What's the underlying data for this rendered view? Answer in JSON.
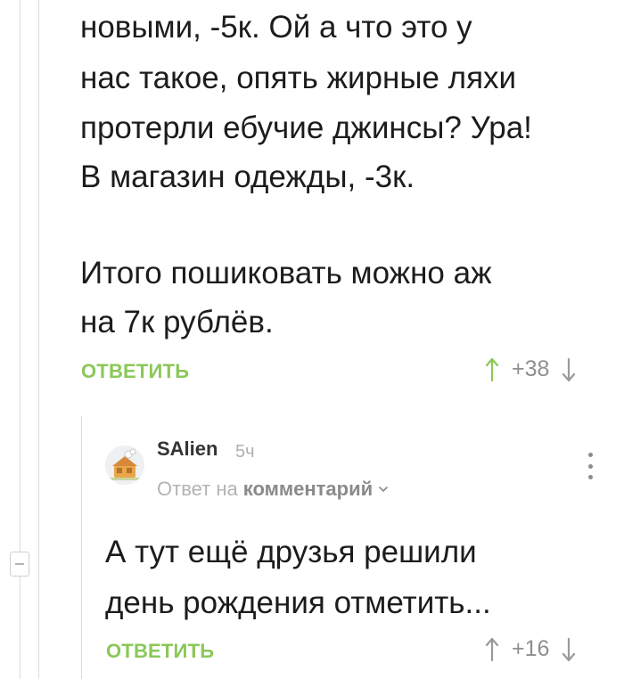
{
  "comment_top": {
    "lines": [
      "новыми, -5к. Ой а что это у",
      "нас такое, опять жирные ляхи",
      "протерли ебучие джинсы? Ура!",
      "В магазин одежды, -3к.",
      "",
      "Итого пошиковать можно аж",
      "на 7к рублёв."
    ],
    "reply_label": "ОТВЕТИТЬ",
    "rating": "+38"
  },
  "comment_reply": {
    "author": "SAlien",
    "time": "5ч",
    "reply_prefix": "Ответ на",
    "reply_target": "комментарий",
    "lines": [
      "А тут ещё друзья решили",
      "день рождения отметить..."
    ],
    "reply_label": "ОТВЕТИТЬ",
    "rating": "+16"
  },
  "icons": {
    "upvote": "arrow-up-icon",
    "downvote": "arrow-down-icon",
    "collapse": "minus-icon",
    "more": "kebab-menu-icon",
    "reply_dropdown": "chevron-down-icon"
  },
  "colors": {
    "accent_green": "#8ac858",
    "text_main": "#1c1c1c",
    "text_muted": "#9a9a9a"
  }
}
